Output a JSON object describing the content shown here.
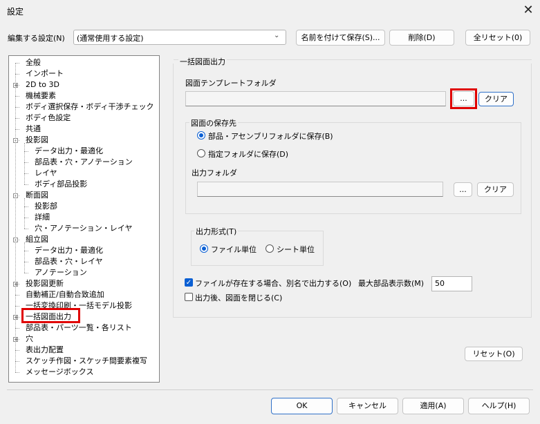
{
  "window": {
    "title": "設定",
    "close_glyph": "✕"
  },
  "top": {
    "label": "編集する設定(N)",
    "combo_value": "(通常使用する設定)",
    "save_as": "名前を付けて保存(S)...",
    "delete": "削除(D)",
    "reset_all": "全リセット(0)"
  },
  "tree": [
    "全般",
    "インポート",
    "2D to 3D",
    "機械要素",
    "ボディ選択保存・ボディ干渉チェック",
    "ボディ色設定",
    "共通",
    "投影図",
    "データ出力・最適化",
    "部品表・穴・アノテーション",
    "レイヤ",
    "ボディ部品投影",
    "断面図",
    "投影部",
    "詳細",
    "穴・アノテーション・レイヤ",
    "組立図",
    "データ出力・最適化",
    "部品表・穴・レイヤ",
    "アノテーション",
    "投影図更新",
    "自動補正/自動合致追加",
    "一括変換印刷・一括モデル投影",
    "一括図面出力",
    "部品表・パーツ一覧・各リスト",
    "穴",
    "表出力配置",
    "スケッチ作図・スケッチ間要素複写",
    "メッセージボックス"
  ],
  "panel": {
    "section_title": "一括図面出力",
    "template_label": "図面テンプレートフォルダ",
    "template_value": "",
    "browse": "...",
    "clear": "クリア",
    "save_dest": {
      "title": "図面の保存先",
      "opt1": "部品・アセンブリフォルダに保存(B)",
      "opt2": "指定フォルダに保存(D)",
      "selected": "opt1"
    },
    "output_folder_label": "出力フォルダ",
    "output_folder_value": "",
    "format": {
      "title": "出力形式(T)",
      "opt1": "ファイル単位",
      "opt2": "シート単位",
      "selected": "opt1"
    },
    "rename_check": "ファイルが存在する場合、別名で出力する(O)",
    "rename_checked": true,
    "close_check": "出力後、図面を閉じる(C)",
    "close_checked": false,
    "max_parts_label": "最大部品表示数(M)",
    "max_parts_value": "50",
    "reset": "リセット(O)"
  },
  "footer": {
    "ok": "OK",
    "cancel": "キャンセル",
    "apply": "適用(A)",
    "help": "ヘルプ(H)"
  }
}
